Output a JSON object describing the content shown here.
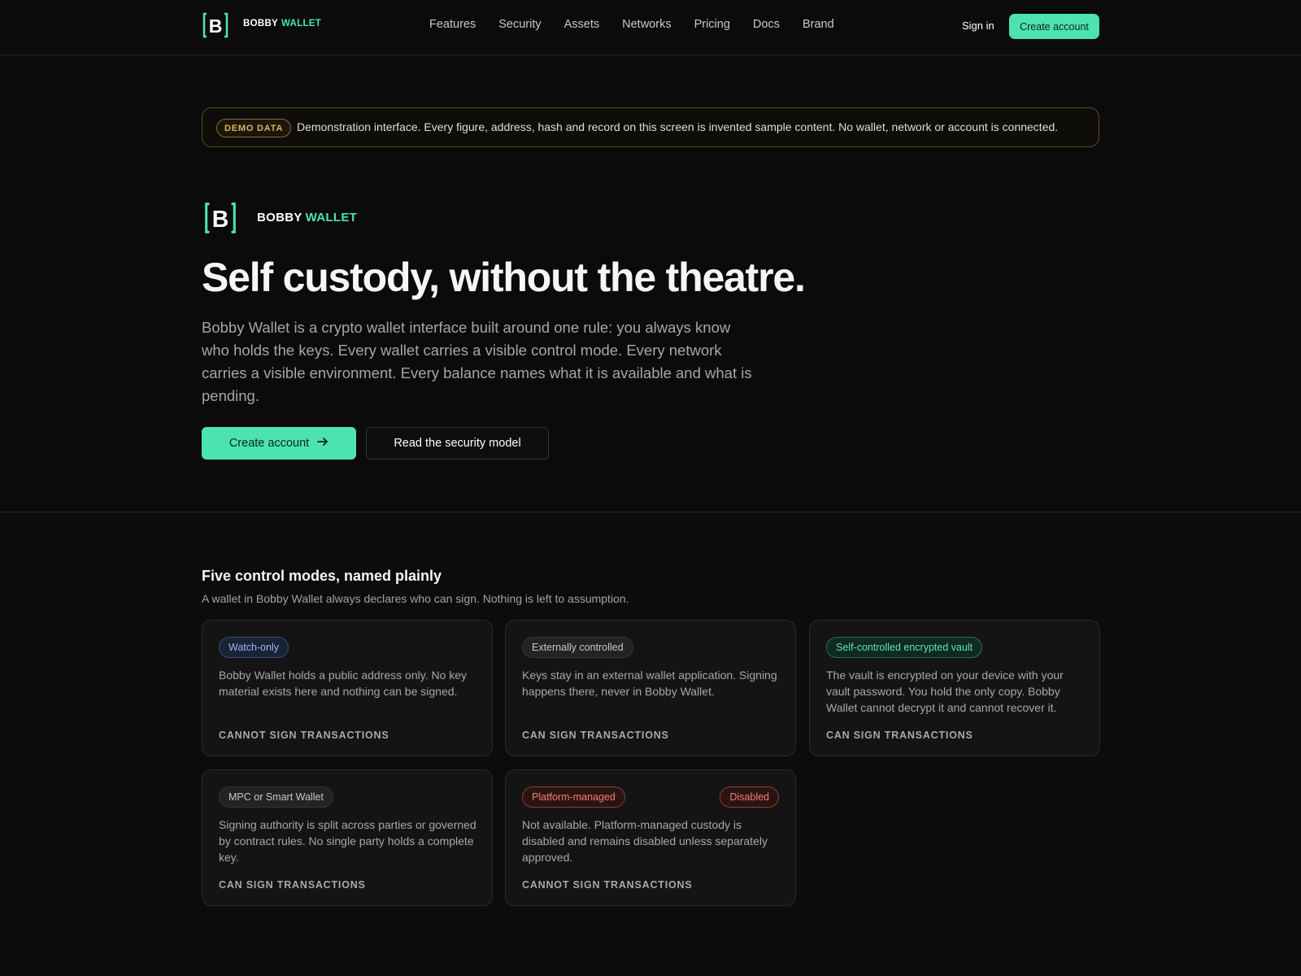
{
  "nav": {
    "brand_1": "BOBBY",
    "brand_2": "WALLET",
    "links": [
      "Features",
      "Security",
      "Assets",
      "Networks",
      "Pricing",
      "Docs",
      "Brand"
    ],
    "signin": "Sign in",
    "cta": "Create account"
  },
  "demo": {
    "badge": "DEMO DATA",
    "text": "Demonstration interface. Every figure, address, hash and record on this screen is invented sample content. No wallet, network or account is connected."
  },
  "hero": {
    "brand_1": "BOBBY",
    "brand_2": "WALLET",
    "title": "Self custody, without the theatre.",
    "description": "Bobby Wallet is a crypto wallet interface built around one rule: you always know who holds the keys. Every wallet carries a visible control mode. Every network carries a visible environment. Every balance names what it is available and what is pending.",
    "primary_cta": "Create account",
    "secondary_cta": "Read the security model"
  },
  "modes": {
    "title": "Five control modes, named plainly",
    "subtitle": "A wallet in Bobby Wallet always declares who can sign. Nothing is left to assumption.",
    "cards": [
      {
        "label": "Watch-only",
        "body": "Bobby Wallet holds a public address only. No key material exists here and nothing can be signed.",
        "footer": "CANNOT SIGN TRANSACTIONS"
      },
      {
        "label": "Externally controlled",
        "body": "Keys stay in an external wallet application. Signing happens there, never in Bobby Wallet.",
        "footer": "CAN SIGN TRANSACTIONS"
      },
      {
        "label": "Self-controlled encrypted vault",
        "body": "The vault is encrypted on your device with your vault password. You hold the only copy. Bobby Wallet cannot decrypt it and cannot recover it.",
        "footer": "CAN SIGN TRANSACTIONS"
      },
      {
        "label": "MPC or Smart Wallet",
        "body": "Signing authority is split across parties or governed by contract rules. No single party holds a complete key.",
        "footer": "CAN SIGN TRANSACTIONS"
      },
      {
        "label": "Platform-managed",
        "status": "Disabled",
        "body": "Not available. Platform-managed custody is disabled and remains disabled unless separately approved.",
        "footer": "CANNOT SIGN TRANSACTIONS"
      }
    ]
  },
  "colors": {
    "accent": "#4de3b0",
    "background": "#0b0b0b",
    "warning": "#e3b25c",
    "danger": "#f0806f",
    "info": "#9db4f2"
  },
  "icons": {
    "logo": "bobby-wallet-logo-icon",
    "arrow": "arrow-right-icon"
  }
}
